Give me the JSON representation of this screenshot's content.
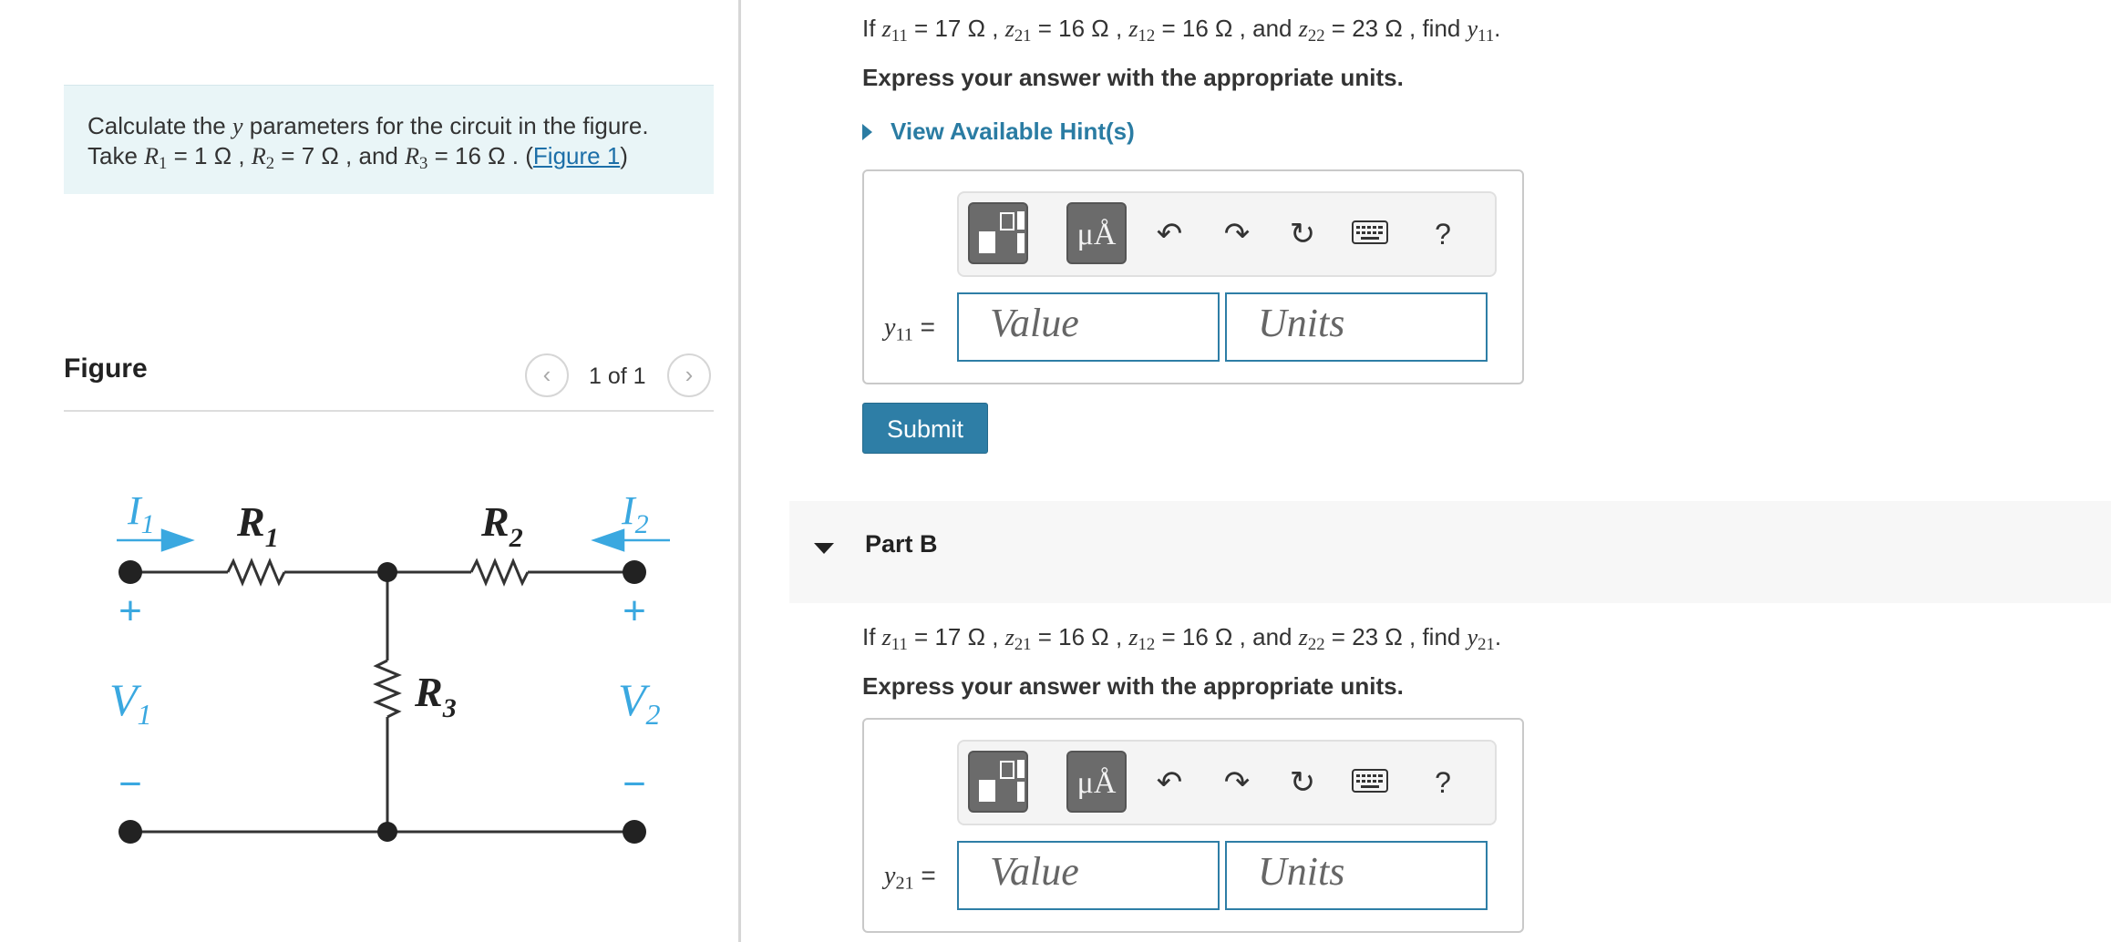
{
  "problem": {
    "text_before": "Calculate the ",
    "y_symbol": "y",
    "text_after": " parameters for the circuit in the figure.",
    "line2_take": "Take ",
    "r1_sym": "R",
    "r1_sub": "1",
    "r1_val": " = 1 Ω , ",
    "r2_sym": "R",
    "r2_sub": "2",
    "r2_val": " = 7 Ω , and ",
    "r3_sym": "R",
    "r3_sub": "3",
    "r3_val": " = 16 Ω . (",
    "figure_link": "Figure 1",
    "close": ")"
  },
  "figure": {
    "title": "Figure",
    "counter": "1 of 1",
    "prev_icon": "chevron-left-icon",
    "next_icon": "chevron-right-icon",
    "labels": {
      "i1": "I",
      "i1_sub": "1",
      "i2": "I",
      "i2_sub": "2",
      "r1": "R",
      "r1_sub": "1",
      "r2": "R",
      "r2_sub": "2",
      "r3": "R",
      "r3_sub": "3",
      "v1": "V",
      "v1_sub": "1",
      "v2": "V",
      "v2_sub": "2",
      "plus": "+",
      "minus": "−"
    },
    "colors": {
      "wire": "#333333",
      "annotation": "#3aa8e0"
    }
  },
  "partA": {
    "q_if": "If ",
    "z11": "z",
    "z11_sub": "11",
    "z11_val": " = 17 Ω , ",
    "z21": "z",
    "z21_sub": "21",
    "z21_val": " = 16 Ω , ",
    "z12": "z",
    "z12_sub": "12",
    "z12_val": " = 16 Ω , and ",
    "z22": "z",
    "z22_sub": "22",
    "z22_val": " = 23 Ω , find ",
    "target": "y",
    "target_sub": "11",
    "q_end": ".",
    "instruction": "Express your answer with the appropriate units.",
    "hint": "View Available Hint(s)",
    "answer_label": "y",
    "answer_label_sub": "11",
    "answer_eq": " =",
    "value_placeholder": "Value",
    "units_placeholder": "Units",
    "submit": "Submit"
  },
  "partB": {
    "title": "Part B",
    "q_if": "If ",
    "z11": "z",
    "z11_sub": "11",
    "z11_val": " = 17 Ω , ",
    "z21": "z",
    "z21_sub": "21",
    "z21_val": " = 16 Ω , ",
    "z12": "z",
    "z12_sub": "12",
    "z12_val": " = 16 Ω , and ",
    "z22": "z",
    "z22_sub": "22",
    "z22_val": " = 23 Ω , find ",
    "target": "y",
    "target_sub": "21",
    "q_end": ".",
    "instruction": "Express your answer with the appropriate units.",
    "answer_label": "y",
    "answer_label_sub": "21",
    "answer_eq": " =",
    "value_placeholder": "Value",
    "units_placeholder": "Units"
  },
  "toolbar": {
    "template_icon": "templates-icon",
    "units_label": "μÅ",
    "undo_icon": "undo-icon",
    "redo_icon": "redo-icon",
    "reset_icon": "reset-icon",
    "keyboard_icon": "keyboard-icon",
    "help_label": "?"
  }
}
